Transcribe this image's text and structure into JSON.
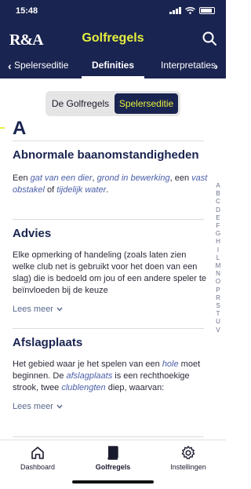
{
  "status": {
    "time": "15:48"
  },
  "header": {
    "logo": "R&A",
    "title": "Golfregels"
  },
  "tabs": [
    "Spelerseditie",
    "Definities",
    "Interpretaties"
  ],
  "segment": {
    "left": "De Golfregels",
    "right": "Spelerseditie"
  },
  "section": {
    "letter": "A"
  },
  "terms": [
    {
      "title": "Abnormale baanomstandigheden",
      "text": {
        "a": "Een ",
        "b": "gat van een dier",
        "c": ", ",
        "d": "grond in bewerking",
        "e": ", een ",
        "f": "vast obstakel",
        "g": " of ",
        "h": "tijdelijk water",
        "i": "."
      }
    },
    {
      "title": "Advies",
      "text": "Elke opmerking of handeling (zoals laten zien welke club net is gebruikt voor het doen van een slag) die is bedoeld om jou of een andere speler te beïnvloeden bij de keuze",
      "more": "Lees meer"
    },
    {
      "title": "Afslagplaats",
      "text": {
        "a": "Het gebied waar je het spelen van een ",
        "b": "hole",
        "c": " moet beginnen. De ",
        "d": "afslagplaats",
        "e": " is een rechthoekige strook, twee ",
        "f": "clublengten",
        "g": " diep, waarvan:"
      },
      "more": "Lees meer"
    }
  ],
  "index": [
    "A",
    "B",
    "C",
    "D",
    "E",
    "F",
    "G",
    "H",
    "I",
    "L",
    "M",
    "N",
    "O",
    "P",
    "R",
    "S",
    "T",
    "U",
    "V"
  ],
  "bottom_nav": [
    {
      "label": "Dashboard",
      "icon": "home-icon"
    },
    {
      "label": "Golfregels",
      "icon": "book-icon"
    },
    {
      "label": "Instellingen",
      "icon": "gear-icon"
    }
  ],
  "colors": {
    "navy": "#1a2450",
    "accent": "#e5f03f",
    "link": "#4a5ea8"
  }
}
